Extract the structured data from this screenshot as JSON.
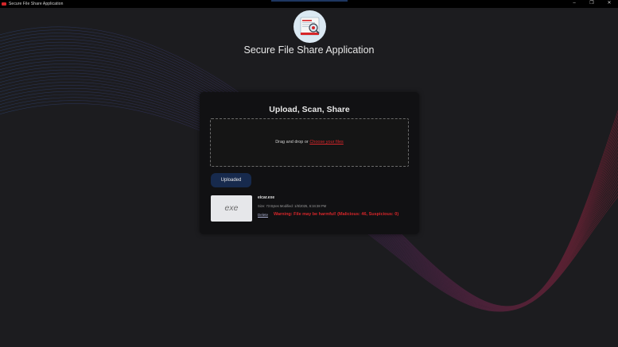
{
  "window": {
    "title": "Secure File Share Application",
    "controls": [
      "–",
      "❐",
      "✕"
    ]
  },
  "header": {
    "app_title": "Secure File Share Application",
    "logo_icon": "file-scan-magnifier-icon"
  },
  "card": {
    "title": "Upload, Scan, Share",
    "dropzone": {
      "text": "Drag and drop or",
      "link": "Choose your files"
    },
    "uploaded_button": "Uploaded",
    "file": {
      "thumbnail_label": "exe",
      "name": "eicar.exe",
      "meta": "Size: 73 Bytes  Modified: 1/8/2025, 6:34:38 PM",
      "delete_label": "Delete",
      "warning": "Warning: File may be harmful! (Malicious: 46, Suspicious: 0)"
    }
  },
  "colors": {
    "background": "#1c1c1f",
    "card": "#111113",
    "accent_red": "#d7262a",
    "button_navy": "#172a4d"
  }
}
